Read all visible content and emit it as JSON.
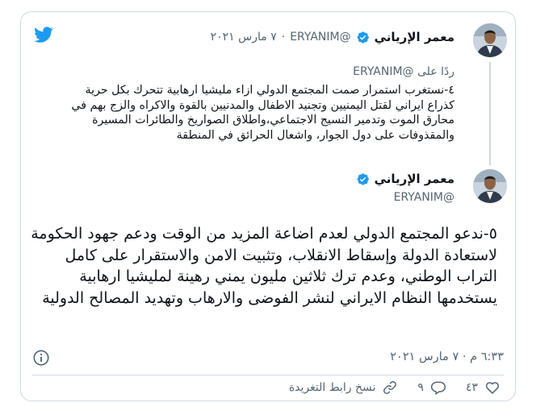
{
  "colors": {
    "brand": "#1d9bf0",
    "text": "#0f1419",
    "muted": "#536471",
    "border": "#cfd9de"
  },
  "quoted_tweet": {
    "name": "معمر الإرياني",
    "handle": "@ERYANIM",
    "separator": "·",
    "date": "٧ مارس ٢٠٢١",
    "replying_prefix": "ردًا على",
    "replying_handle": "@ERYANIM",
    "text": "٤-نستغرب استمرار صمت المجتمع الدولي ازاء مليشيا ارهابية تتحرك بكل حرية كذراع ايراني لقتل اليمنيين وتجنيد الاطفال والمدنيين بالقوة والاكراه والزج بهم في محارق الموت وتدمير النسيج الاجتماعي،واطلاق الصواريخ والطائرات المسيرة والمقذوفات على دول الجوار، واشعال الحرائق في المنطقة"
  },
  "main_tweet": {
    "name": "معمر الإرياني",
    "handle": "@ERYANIM",
    "text": "٥-ندعو المجتمع الدولي لعدم اضاعة المزيد من الوقت ودعم جهود الحكومة لاستعادة الدولة وإسقاط الانقلاب، وتثبيت الامن والاستقرار على كامل التراب الوطني، وعدم ترك ثلاثين مليون يمني رهينة لمليشيا ارهابية يستخدمها النظام الايراني لنشر الفوضى والارهاب وتهديد المصالح الدولية",
    "timestamp": "٦:٣٣ م · ٧ مارس ٢٠٢١"
  },
  "actions": {
    "like_count": "٤٣",
    "reply_count": "٩",
    "copy_link_label": "نسخ رابط التغريدة"
  },
  "icons": {
    "logo": "twitter-bird-icon",
    "verified": "verified-badge-icon",
    "info": "info-icon",
    "like": "heart-icon",
    "reply": "reply-icon",
    "link": "link-icon"
  }
}
